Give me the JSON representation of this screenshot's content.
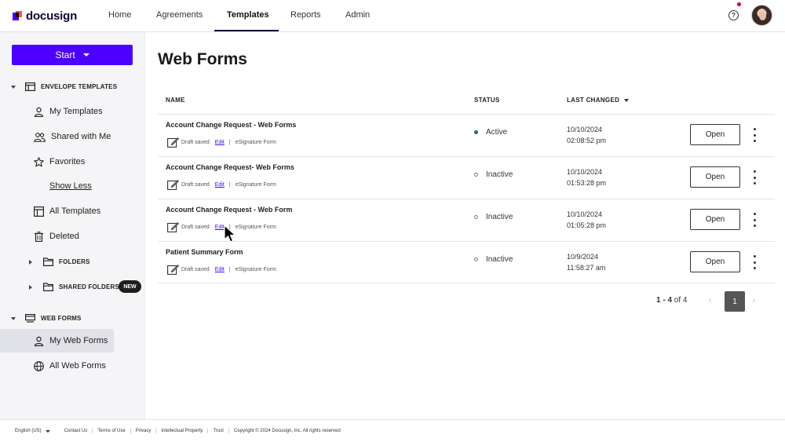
{
  "brand": {
    "name": "docusign"
  },
  "nav": {
    "items": [
      {
        "label": "Home"
      },
      {
        "label": "Agreements"
      },
      {
        "label": "Templates"
      },
      {
        "label": "Reports"
      },
      {
        "label": "Admin"
      }
    ],
    "active": "Templates",
    "help_icon": "help-circle-icon",
    "help_glyph": "?"
  },
  "sidebar": {
    "start_label": "Start",
    "envelope_templates": {
      "label": "ENVELOPE TEMPLATES",
      "items": [
        {
          "label": "My Templates",
          "icon": "person-icon"
        },
        {
          "label": "Shared with Me",
          "icon": "people-icon"
        },
        {
          "label": "Favorites",
          "icon": "star-icon"
        }
      ],
      "show_less": "Show Less",
      "more_items": [
        {
          "label": "All Templates",
          "icon": "template-grid-icon"
        },
        {
          "label": "Deleted",
          "icon": "trash-icon"
        }
      ],
      "folders": "FOLDERS",
      "shared_folders": "SHARED FOLDERS"
    },
    "web_forms": {
      "label": "WEB FORMS",
      "badge": "NEW",
      "items": [
        {
          "label": "My Web Forms",
          "icon": "person-icon",
          "selected": true
        },
        {
          "label": "All Web Forms",
          "icon": "globe-icon"
        }
      ]
    }
  },
  "main": {
    "title": "Web Forms",
    "columns": {
      "name": "NAME",
      "status": "STATUS",
      "last_changed": "LAST CHANGED"
    },
    "rows": [
      {
        "name": "Account Change Request - Web Forms",
        "draft": "Draft saved",
        "edit": "Edit",
        "sep": "|",
        "type": "eSignature Form",
        "status": "Active",
        "date": "10/10/2024",
        "time": "02:08:52 pm",
        "open": "Open"
      },
      {
        "name": "Account Change Request- Web Forms",
        "draft": "Draft saved",
        "edit": "Edit",
        "sep": "|",
        "type": "eSignature Form",
        "status": "Inactive",
        "date": "10/10/2024",
        "time": "01:53:28 pm",
        "open": "Open"
      },
      {
        "name": "Account Change Request - Web Form",
        "draft": "Draft saved",
        "edit": "Edit",
        "sep": "|",
        "type": "eSignature Form",
        "status": "Inactive",
        "date": "10/10/2024",
        "time": "01:05:28 pm",
        "open": "Open"
      },
      {
        "name": "Patient Summary Form",
        "draft": "Draft saved",
        "edit": "Edit",
        "sep": "|",
        "type": "eSignature Form",
        "status": "Inactive",
        "date": "10/9/2024",
        "time": "11:58:27 am",
        "open": "Open"
      }
    ],
    "pager": {
      "range": "1 - 4",
      "of_label": "of 4",
      "page": "1",
      "prev": "‹",
      "next": "›"
    }
  },
  "footer": {
    "language": "English (US)",
    "links": [
      "Contact Us",
      "Terms of Use",
      "Privacy",
      "Intellectual Property",
      "Trust"
    ],
    "copyright": "Copyright © 2024 Docusign, Inc. All rights reserved"
  },
  "colors": {
    "brand_purple": "#4c00ff",
    "active_green": "#2f6b4e",
    "notification": "#d10050"
  }
}
